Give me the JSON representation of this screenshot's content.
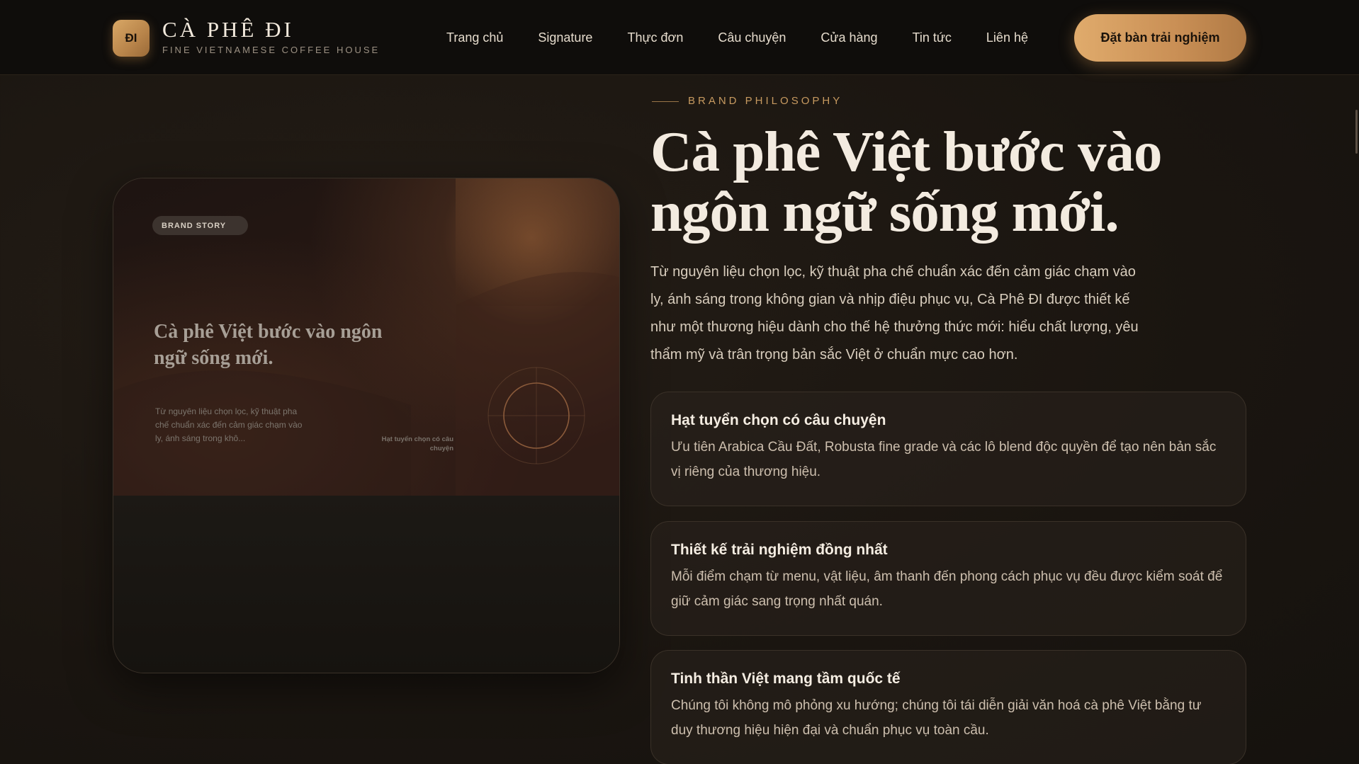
{
  "brand": {
    "badge": "ĐI",
    "name": "CÀ PHÊ ĐI",
    "tagline": "FINE VIETNAMESE COFFEE HOUSE"
  },
  "nav": {
    "links": [
      "Trang chủ",
      "Signature",
      "Thực đơn",
      "Câu chuyện",
      "Cửa hàng",
      "Tin tức",
      "Liên hệ"
    ],
    "cta": "Đặt bàn trải nghiệm"
  },
  "card": {
    "badge": "BRAND STORY",
    "heading": "Cà phê Việt bước vào ngôn ngữ sống mới.",
    "text": "Từ nguyên liệu chọn lọc, kỹ thuật pha chế chuẩn xác đến cảm giác chạm vào ly, ánh sáng trong khô...",
    "caption": "Hạt tuyển chọn có câu chuyện"
  },
  "section": {
    "eyebrow": "BRAND PHILOSOPHY",
    "headline": "Cà phê Việt bước vào ngôn ngữ sống mới.",
    "lead": "Từ nguyên liệu chọn lọc, kỹ thuật pha chế chuẩn xác đến cảm giác chạm vào ly, ánh sáng trong không gian và nhịp điệu phục vụ, Cà Phê ĐI được thiết kế như một thương hiệu dành cho thế hệ thưởng thức mới: hiểu chất lượng, yêu thẩm mỹ và trân trọng bản sắc Việt ở chuẩn mực cao hơn.",
    "features": [
      {
        "title": "Hạt tuyển chọn có câu chuyện",
        "desc": "Ưu tiên Arabica Cầu Đất, Robusta fine grade và các lô blend độc quyền để tạo nên bản sắc vị riêng của thương hiệu."
      },
      {
        "title": "Thiết kế trải nghiệm đồng nhất",
        "desc": "Mỗi điểm chạm từ menu, vật liệu, âm thanh đến phong cách phục vụ đều được kiểm soát để giữ cảm giác sang trọng nhất quán."
      },
      {
        "title": "Tinh thần Việt mang tầm quốc tế",
        "desc": "Chúng tôi không mô phỏng xu hướng; chúng tôi tái diễn giải văn hoá cà phê Việt bằng tư duy thương hiệu hiện đại và chuẩn phục vụ toàn cầu."
      }
    ]
  },
  "colors": {
    "accent": "#c98f55",
    "background": "#1c1712",
    "nav_bg": "#0f0d0b"
  }
}
